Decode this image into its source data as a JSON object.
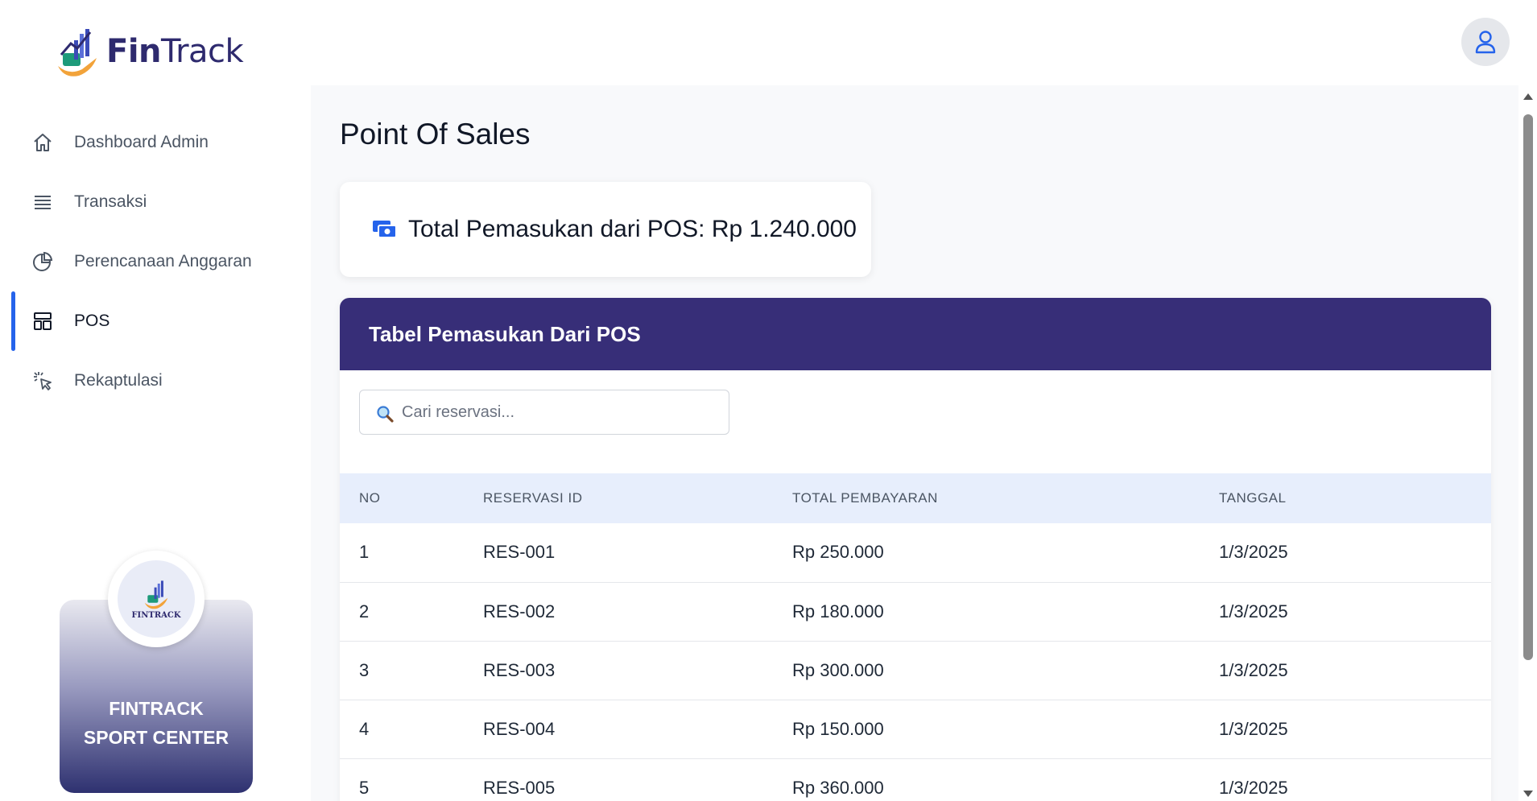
{
  "app": {
    "logo_bold": "Fin",
    "logo_light": "Track",
    "user_icon": "user-icon"
  },
  "sidebar": {
    "items": [
      {
        "label": "Dashboard Admin",
        "icon": "home-icon"
      },
      {
        "label": "Transaksi",
        "icon": "list-icon"
      },
      {
        "label": "Perencanaan Anggaran",
        "icon": "pie-chart-icon"
      },
      {
        "label": "POS",
        "icon": "layout-icon",
        "active": true
      },
      {
        "label": "Rekaptulasi",
        "icon": "cursor-click-icon"
      }
    ],
    "brand_badge_text": "FINTRACK",
    "brand_line1": "FINTRACK",
    "brand_line2": "SPORT CENTER"
  },
  "main": {
    "page_title": "Point Of Sales",
    "total_text": "Total Pemasukan dari POS: Rp 1.240.000",
    "table_title": "Tabel Pemasukan Dari POS",
    "search_placeholder": "Cari reservasi...",
    "columns": [
      "NO",
      "RESERVASI ID",
      "TOTAL PEMBAYARAN",
      "TANGGAL"
    ],
    "rows": [
      {
        "no": "1",
        "id": "RES-001",
        "total": "Rp 250.000",
        "date": "1/3/2025"
      },
      {
        "no": "2",
        "id": "RES-002",
        "total": "Rp 180.000",
        "date": "1/3/2025"
      },
      {
        "no": "3",
        "id": "RES-003",
        "total": "Rp 300.000",
        "date": "1/3/2025"
      },
      {
        "no": "4",
        "id": "RES-004",
        "total": "Rp 150.000",
        "date": "1/3/2025"
      },
      {
        "no": "5",
        "id": "RES-005",
        "total": "Rp 360.000",
        "date": "1/3/2025"
      }
    ]
  },
  "colors": {
    "accent": "#2563eb",
    "table_header_bar": "#372e78",
    "table_column_header": "#e7eefc"
  }
}
